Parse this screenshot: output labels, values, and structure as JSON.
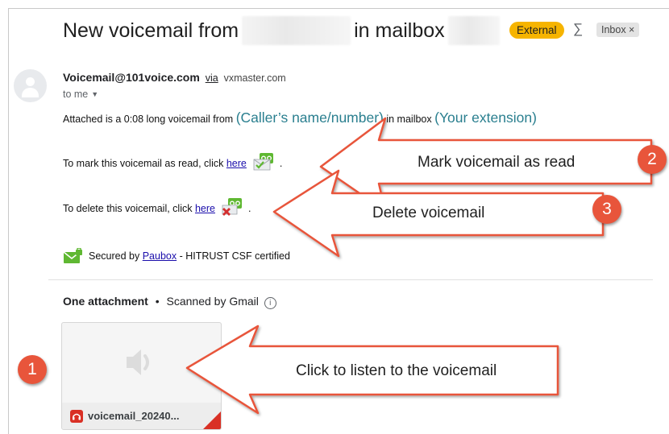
{
  "header": {
    "subject_prefix": "New voicemail from",
    "subject_middle": "in mailbox",
    "external_badge": "External",
    "label_icon": "label-sigma-icon",
    "inbox_chip": "Inbox ×"
  },
  "sender": {
    "address": "Voicemail@101voice.com",
    "via_label": "via",
    "via_domain": "vxmaster.com",
    "to": "to me",
    "avatar_icon": "person-icon"
  },
  "body": {
    "line1_prefix": "Attached is a 0:08 long voicemail from",
    "caller_placeholder": "(Caller’s name/number)",
    "line1_middle": "in mailbox",
    "extension_placeholder": "(Your extension)",
    "mark_read_prefix": "To mark this voicemail as read, click",
    "delete_prefix": "To delete this voicemail, click",
    "link_text": "here",
    "period": ".",
    "secured_prefix": "Secured by",
    "secured_link": "Paubox",
    "secured_suffix": "- HITRUST CSF certified"
  },
  "attachments": {
    "title": "One attachment",
    "separator": "•",
    "scanned": "Scanned by Gmail",
    "info_icon": "info-icon",
    "file_name": "voicemail_20240...",
    "file_icon": "audio-file-icon"
  },
  "annotations": {
    "mark_read": "Mark voicemail as read",
    "delete": "Delete voicemail",
    "listen": "Click to listen to the voicemail",
    "num1": "1",
    "num2": "2",
    "num3": "3"
  },
  "colors": {
    "external_badge": "#f6b400",
    "annotation_arrow": "#e8553b",
    "teal_placeholder": "#2a7f8f",
    "link": "#1a0dab",
    "paubox_green": "#5fb832"
  }
}
